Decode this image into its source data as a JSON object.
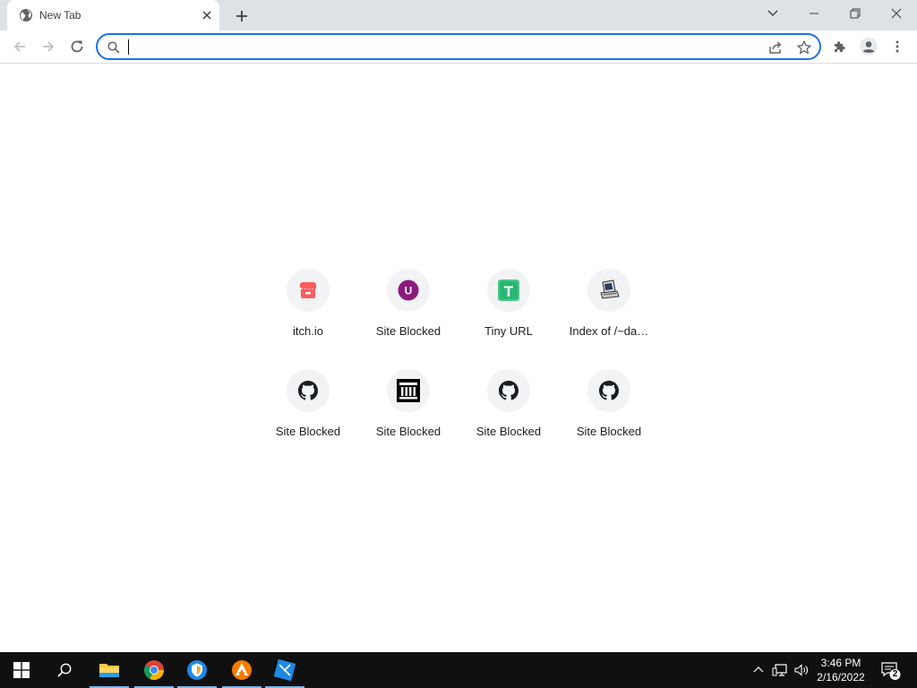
{
  "browser": {
    "tab": {
      "title": "New Tab",
      "favicon": "globe-icon"
    },
    "omnibox": {
      "value": "",
      "placeholder": ""
    }
  },
  "shortcuts": [
    {
      "title": "itch.io",
      "icon": "itchio-icon"
    },
    {
      "title": "Site Blocked",
      "icon": "letter-u-icon",
      "letter": "U"
    },
    {
      "title": "Tiny URL",
      "icon": "tinyurl-icon",
      "letter": "T"
    },
    {
      "title": "Index of /~da…",
      "icon": "computer-icon"
    },
    {
      "title": "Site Blocked",
      "icon": "github-icon"
    },
    {
      "title": "Site Blocked",
      "icon": "museum-icon"
    },
    {
      "title": "Site Blocked",
      "icon": "github-icon"
    },
    {
      "title": "Site Blocked",
      "icon": "github-icon"
    }
  ],
  "taskbar": {
    "time": "3:46 PM",
    "date": "2/16/2022",
    "notification_count": "2",
    "apps": [
      "file-explorer-icon",
      "chrome-icon",
      "vpn-shield-icon",
      "app-orange-icon",
      "app-blue-icon"
    ]
  },
  "colors": {
    "accent": "#1a73e8",
    "tabstrip": "#dee1e6",
    "taskbar": "#101010"
  }
}
